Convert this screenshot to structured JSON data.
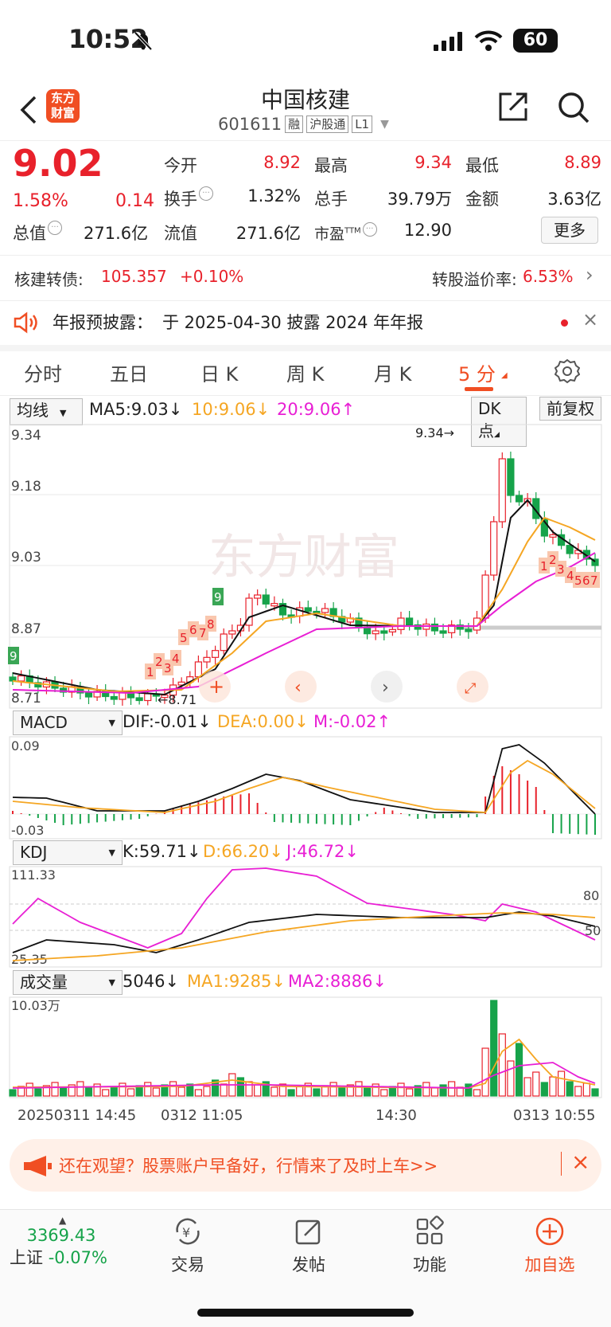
{
  "status": {
    "time": "10:52",
    "battery": "60"
  },
  "header": {
    "logo_line1": "东方",
    "logo_line2": "财富",
    "title": "中国核建",
    "code": "601611",
    "tags": [
      "融",
      "沪股通",
      "L1"
    ]
  },
  "quote": {
    "price": "9.02",
    "pct": "1.58%",
    "change": "0.14",
    "total_cap_label": "总值",
    "total_cap": "271.6亿",
    "open_label": "今开",
    "open": "8.92",
    "high_label": "最高",
    "high": "9.34",
    "low_label": "最低",
    "low": "8.89",
    "turnover_label": "换手",
    "turnover": "1.32%",
    "volume_label": "总手",
    "volume": "39.79万",
    "amount_label": "金额",
    "amount": "3.63亿",
    "float_label": "流值",
    "float_cap": "271.6亿",
    "pe_label": "市盈",
    "pe_sup": "TTM",
    "pe": "12.90",
    "more": "更多"
  },
  "bond": {
    "label": "核建转债:",
    "price": "105.357",
    "pct": "+0.10%",
    "premium_label": "转股溢价率:",
    "premium": "6.53%"
  },
  "notice": {
    "label": "年报预披露：",
    "text": "于 2025-04-30 披露 2024 年年报"
  },
  "tabs": [
    "分时",
    "五日",
    "日 K",
    "周 K",
    "月 K",
    "5 分"
  ],
  "ma_row": {
    "selector": "均线",
    "ma5": "MA5:9.03",
    "ma10": "10:9.06",
    "ma20": "20:9.06",
    "dk": "DK 点",
    "adjust": "前复权"
  },
  "price_chart_labels": {
    "top": "9.34",
    "mid1": "9.18",
    "mid2": "9.03",
    "mid3": "8.87",
    "bottom": "8.71",
    "hi_mark": "9.34",
    "lo_mark": "8.71",
    "watermark": "东方财富"
  },
  "macd": {
    "selector": "MACD",
    "dif": "DIF:-0.01",
    "dea": "DEA:0.00",
    "m": "M:-0.02",
    "top": "0.09",
    "bottom": "-0.03"
  },
  "kdj": {
    "selector": "KDJ",
    "k": "K:59.71",
    "d": "D:66.20",
    "j": "J:46.72",
    "top": "111.33",
    "bottom": "25.35",
    "l80": "80",
    "l50": "50"
  },
  "volume": {
    "selector": "成交量",
    "v": "5046",
    "ma1": "MA1:9285",
    "ma2": "MA2:8886",
    "top": "10.03万"
  },
  "time_axis": [
    "20250311 14:45",
    "0312 11:05",
    "14:30",
    "0313 10:55"
  ],
  "banner": {
    "text": "还在观望？股票账户早备好，行情来了及时上车>>"
  },
  "nav": {
    "index_value": "3369.43",
    "index_name": "上证",
    "index_pct": "-0.07%",
    "trade": "交易",
    "post": "发帖",
    "func": "功能",
    "add": "加自选"
  },
  "colors": {
    "up": "#e8212b",
    "down": "#16a34a",
    "ma10": "#f5a623",
    "ma20": "#e81fd4",
    "brand": "#f04e23"
  }
}
